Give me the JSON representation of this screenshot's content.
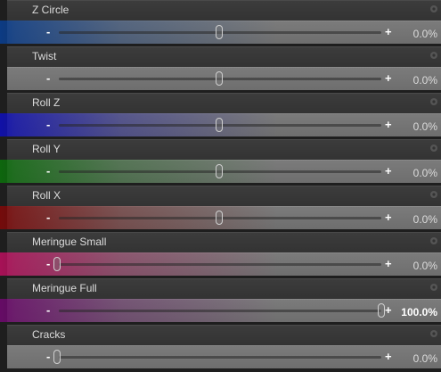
{
  "sliders": [
    {
      "label": "Z Circle",
      "value": "0.0%",
      "position": 0.5,
      "color": "#0b3d8a",
      "value_bold": false
    },
    {
      "label": "Twist",
      "value": "0.0%",
      "position": 0.5,
      "color": "",
      "value_bold": false
    },
    {
      "label": "Roll Z",
      "value": "0.0%",
      "position": 0.5,
      "color": "#1010b0",
      "value_bold": false
    },
    {
      "label": "Roll Y",
      "value": "0.0%",
      "position": 0.5,
      "color": "#0d6b0d",
      "value_bold": false
    },
    {
      "label": "Roll X",
      "value": "0.0%",
      "position": 0.5,
      "color": "#7a0a0a",
      "value_bold": false
    },
    {
      "label": "Meringue Small",
      "value": "0.0%",
      "position": 0.0,
      "color": "#b0105a",
      "value_bold": false
    },
    {
      "label": "Meringue Full",
      "value": "100.0%",
      "position": 1.0,
      "color": "#6a0a6a",
      "value_bold": true
    },
    {
      "label": "Cracks",
      "value": "0.0%",
      "position": 0.0,
      "color": "",
      "value_bold": false
    }
  ],
  "controls": {
    "minus_label": "-",
    "plus_label": "+"
  },
  "icons": {
    "settings": "gear-icon"
  }
}
